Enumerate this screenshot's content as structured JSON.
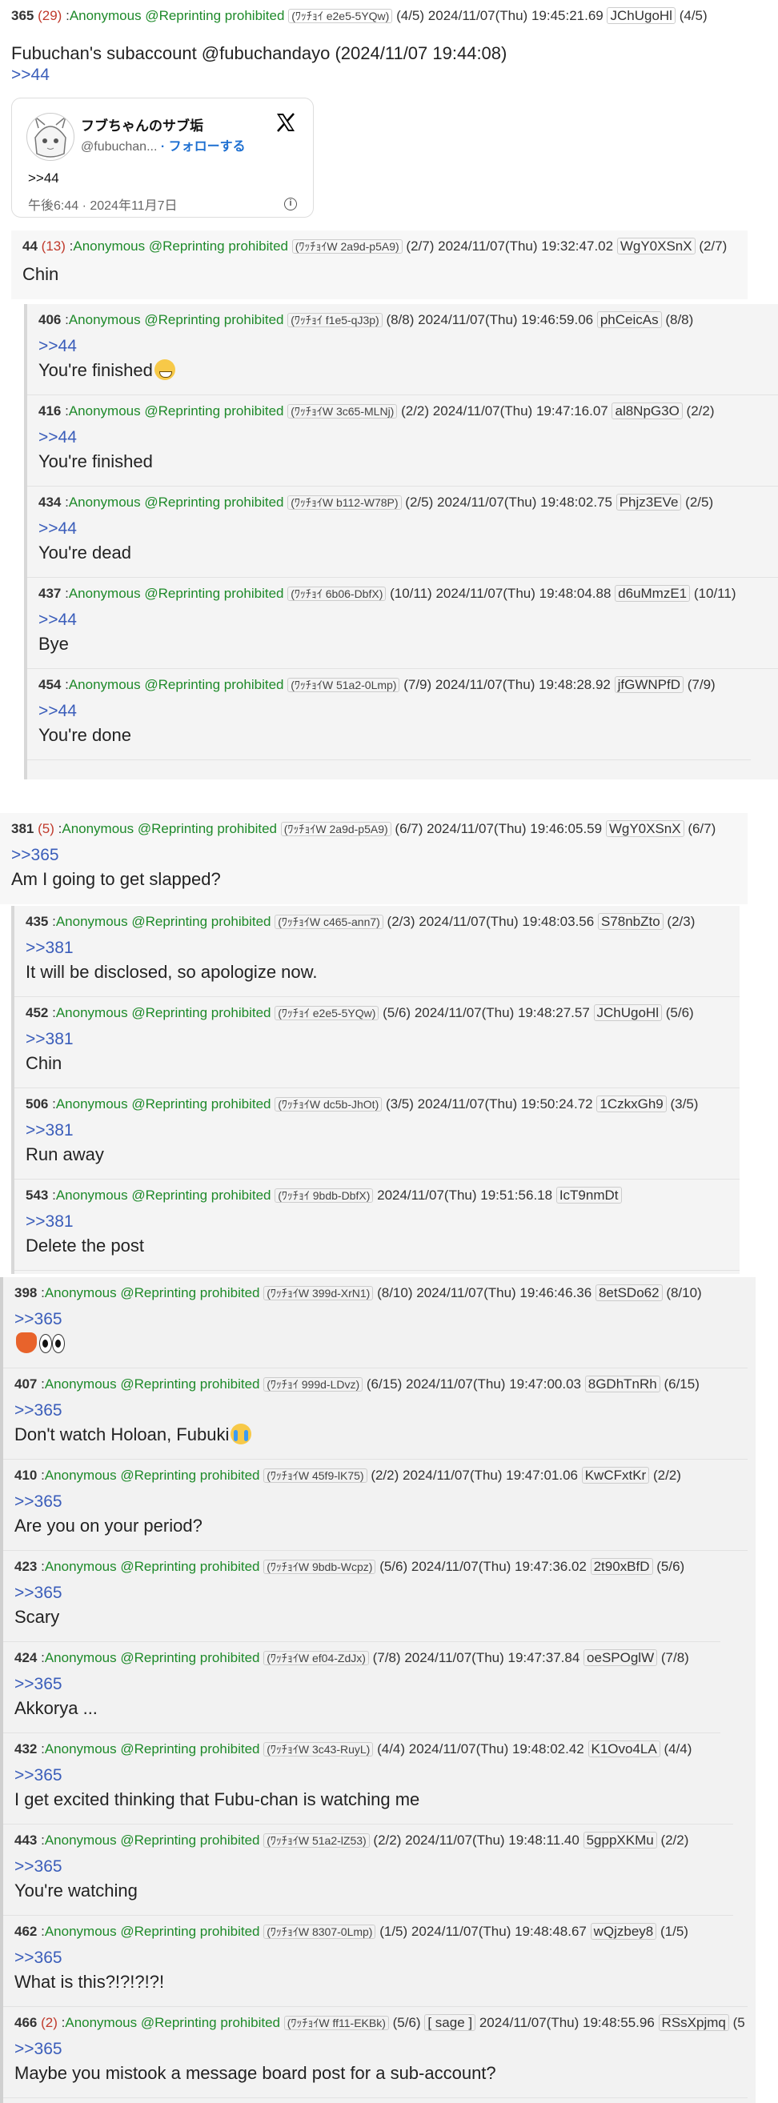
{
  "op": {
    "num": "365",
    "count": "(29)",
    "sep": ":",
    "name": "Anonymous @Reprinting prohibited",
    "wtag": "(ﾜｯﾁｮｲ e2e5-5YQw)",
    "ratio": "(4/5)",
    "date": "2024/11/07(Thu) 19:45:21.69",
    "id": "JChUgoHl",
    "ratio2": "(4/5)",
    "title": "Fubuchan's subaccount @fubuchandayo (2024/11/07 19:44:08)",
    "ref": ">>44"
  },
  "tweet": {
    "display_name": "フブちゃんのサブ垢",
    "handle": "@fubuchan...",
    "follow": "· フォローする",
    "text": ">>44",
    "time": "午後6:44 · 2024年11月7日",
    "x_icon": "x-logo-icon",
    "info_icon": "info-icon"
  },
  "quoted": {
    "num": "44",
    "count": "(13)",
    "sep": ":",
    "name": "Anonymous @Reprinting prohibited",
    "wtag": "(ﾜｯﾁｮｲW 2a9d-p5A9)",
    "ratio": "(2/7)",
    "date": "2024/11/07(Thu) 19:32:47.02",
    "id": "WgY0XSnX",
    "ratio2": "(2/7)",
    "body": "Chin"
  },
  "replies_a": [
    {
      "num": "406",
      "wtag": "(ﾜｯﾁｮｲ f1e5-qJ3p)",
      "ratio": "(8/8)",
      "date": "2024/11/07(Thu) 19:46:59.06",
      "id": "phCeicAs",
      "ratio2": "(8/8)",
      "ref": ">>44",
      "body": "You're finished",
      "emoji": "grin"
    },
    {
      "num": "416",
      "wtag": "(ﾜｯﾁｮｲW 3c65-MLNj)",
      "ratio": "(2/2)",
      "date": "2024/11/07(Thu) 19:47:16.07",
      "id": "al8NpG3O",
      "ratio2": "(2/2)",
      "ref": ">>44",
      "body": "You're finished",
      "emoji": ""
    },
    {
      "num": "434",
      "wtag": "(ﾜｯﾁｮｲW b112-W78P)",
      "ratio": "(2/5)",
      "date": "2024/11/07(Thu) 19:48:02.75",
      "id": "Phjz3EVe",
      "ratio2": "(2/5)",
      "ref": ">>44",
      "body": "You're dead",
      "emoji": ""
    },
    {
      "num": "437",
      "wtag": "(ﾜｯﾁｮｲ 6b06-DbfX)",
      "ratio": "(10/11)",
      "date": "2024/11/07(Thu) 19:48:04.88",
      "id": "d6uMmzE1",
      "ratio2": "(10/11)",
      "ref": ">>44",
      "body": "Bye",
      "emoji": ""
    },
    {
      "num": "454",
      "wtag": "(ﾜｯﾁｮｲW 51a2-0Lmp)",
      "ratio": "(7/9)",
      "date": "2024/11/07(Thu) 19:48:28.92",
      "id": "jfGWNPfD",
      "ratio2": "(7/9)",
      "ref": ">>44",
      "body": "You're done",
      "emoji": ""
    }
  ],
  "post381": {
    "num": "381",
    "count": "(5)",
    "sep": ":",
    "name": "Anonymous @Reprinting prohibited",
    "wtag": "(ﾜｯﾁｮｲW 2a9d-p5A9)",
    "ratio": "(6/7)",
    "date": "2024/11/07(Thu) 19:46:05.59",
    "id": "WgY0XSnX",
    "ratio2": "(6/7)",
    "ref": ">>365",
    "body": "Am I going to get slapped?"
  },
  "replies_b": [
    {
      "num": "435",
      "wtag": "(ﾜｯﾁｮｲW c465-ann7)",
      "ratio": "(2/3)",
      "date": "2024/11/07(Thu) 19:48:03.56",
      "id": "S78nbZto",
      "ratio2": "(2/3)",
      "ref": ">>381",
      "body": "It will be disclosed, so apologize now."
    },
    {
      "num": "452",
      "wtag": "(ﾜｯﾁｮｲ e2e5-5YQw)",
      "ratio": "(5/6)",
      "date": "2024/11/07(Thu) 19:48:27.57",
      "id": "JChUgoHl",
      "ratio2": "(5/6)",
      "ref": ">>381",
      "body": "Chin"
    },
    {
      "num": "506",
      "wtag": "(ﾜｯﾁｮｲW dc5b-JhOt)",
      "ratio": "(3/5)",
      "date": "2024/11/07(Thu) 19:50:24.72",
      "id": "1CzkxGh9",
      "ratio2": "(3/5)",
      "ref": ">>381",
      "body": "Run away"
    },
    {
      "num": "543",
      "wtag": "(ﾜｯﾁｮｲ 9bdb-DbfX)",
      "ratio": "",
      "date": "2024/11/07(Thu) 19:51:56.18",
      "id": "IcT9nmDt",
      "ratio2": "",
      "ref": ">>381",
      "body": "Delete the post"
    }
  ],
  "replies_c": [
    {
      "num": "398",
      "count": "",
      "wtag": "(ﾜｯﾁｮｲW 399d-XrN1)",
      "ratio": "(8/10)",
      "sage": "",
      "date": "2024/11/07(Thu) 19:46:46.36",
      "id": "8etSDo62",
      "ratio2": "(8/10)",
      "ref": ">>365",
      "body": "",
      "emoji": "fox-eyes"
    },
    {
      "num": "407",
      "count": "",
      "wtag": "(ﾜｯﾁｮｲ 999d-LDvz)",
      "ratio": "(6/15)",
      "sage": "",
      "date": "2024/11/07(Thu) 19:47:00.03",
      "id": "8GDhTnRh",
      "ratio2": "(6/15)",
      "ref": ">>365",
      "body": "Don't watch Holoan, Fubuki",
      "emoji": "cry"
    },
    {
      "num": "410",
      "count": "",
      "wtag": "(ﾜｯﾁｮｲW 45f9-lK75)",
      "ratio": "(2/2)",
      "sage": "",
      "date": "2024/11/07(Thu) 19:47:01.06",
      "id": "KwCFxtKr",
      "ratio2": "(2/2)",
      "ref": ">>365",
      "body": "Are you on your period?",
      "emoji": ""
    },
    {
      "num": "423",
      "count": "",
      "wtag": "(ﾜｯﾁｮｲW 9bdb-Wcpz)",
      "ratio": "(5/6)",
      "sage": "",
      "date": "2024/11/07(Thu) 19:47:36.02",
      "id": "2t90xBfD",
      "ratio2": "(5/6)",
      "ref": ">>365",
      "body": "Scary",
      "emoji": ""
    },
    {
      "num": "424",
      "count": "",
      "wtag": "(ﾜｯﾁｮｲW ef04-ZdJx)",
      "ratio": "(7/8)",
      "sage": "",
      "date": "2024/11/07(Thu) 19:47:37.84",
      "id": "oeSPOglW",
      "ratio2": "(7/8)",
      "ref": ">>365",
      "body": "Akkorya ...",
      "emoji": ""
    },
    {
      "num": "432",
      "count": "",
      "wtag": "(ﾜｯﾁｮｲW 3c43-RuyL)",
      "ratio": "(4/4)",
      "sage": "",
      "date": "2024/11/07(Thu) 19:48:02.42",
      "id": "K1Ovo4LA",
      "ratio2": "(4/4)",
      "ref": ">>365",
      "body": "I get excited thinking that Fubu-chan is watching me",
      "emoji": ""
    },
    {
      "num": "443",
      "count": "",
      "wtag": "(ﾜｯﾁｮｲW 51a2-lZ53)",
      "ratio": "(2/2)",
      "sage": "",
      "date": "2024/11/07(Thu) 19:48:11.40",
      "id": "5gppXKMu",
      "ratio2": "(2/2)",
      "ref": ">>365",
      "body": "You're watching",
      "emoji": ""
    },
    {
      "num": "462",
      "count": "",
      "wtag": "(ﾜｯﾁｮｲW 8307-0Lmp)",
      "ratio": "(1/5)",
      "sage": "",
      "date": "2024/11/07(Thu) 19:48:48.67",
      "id": "wQjzbey8",
      "ratio2": "(1/5)",
      "ref": ">>365",
      "body": "What is this?!?!?!?!",
      "emoji": ""
    },
    {
      "num": "466",
      "count": "(2)",
      "wtag": "(ﾜｯﾁｮｲW ff11-EKBk)",
      "ratio": "(5/6)",
      "sage": "[ sage ]",
      "date": "2024/11/07(Thu) 19:48:55.96",
      "id": "RSsXpjmq",
      "ratio2": "(5",
      "ref": ">>365",
      "body": "Maybe you mistook a message board post for a sub-account?",
      "emoji": ""
    }
  ],
  "common": {
    "name": "Anonymous @Reprinting prohibited",
    "sep": ":"
  }
}
